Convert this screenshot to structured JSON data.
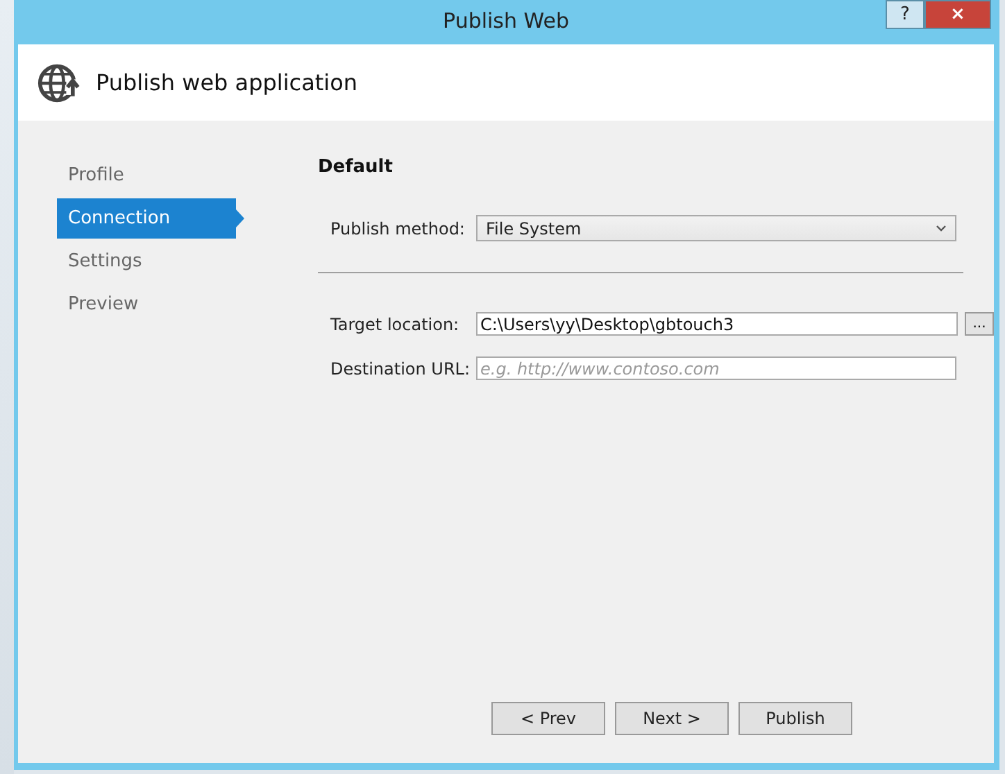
{
  "window": {
    "title": "Publish Web",
    "help_button": "?",
    "close_button": "×"
  },
  "header": {
    "title": "Publish web application"
  },
  "sidebar": {
    "items": [
      {
        "label": "Profile",
        "selected": false
      },
      {
        "label": "Connection",
        "selected": true
      },
      {
        "label": "Settings",
        "selected": false
      },
      {
        "label": "Preview",
        "selected": false
      }
    ]
  },
  "section_title": "Default",
  "publish_method": {
    "label": "Publish method:",
    "value": "File System"
  },
  "target_location": {
    "label": "Target location:",
    "value": "C:\\Users\\yy\\Desktop\\gbtouch3",
    "browse": "..."
  },
  "destination_url": {
    "label": "Destination URL:",
    "placeholder": "e.g. http://www.contoso.com"
  },
  "buttons": [
    "< Prev",
    "Next >",
    "Publish"
  ]
}
